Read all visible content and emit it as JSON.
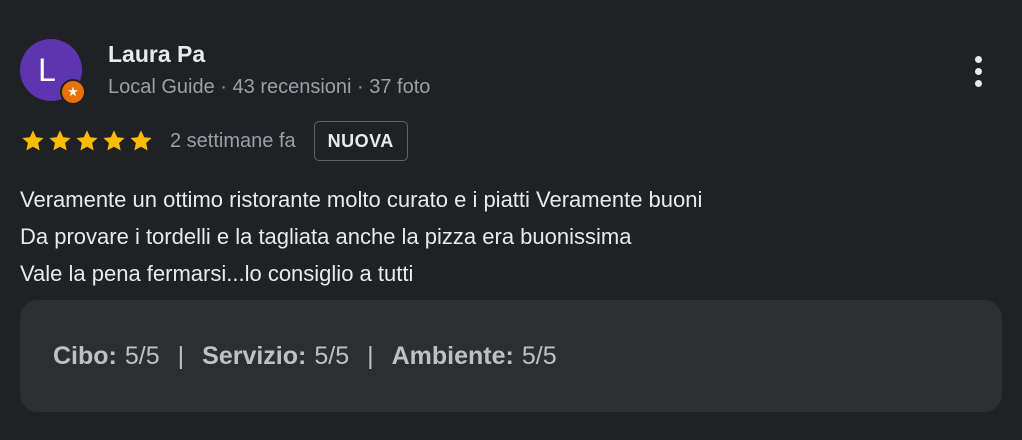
{
  "author": {
    "initial": "L",
    "name": "Laura Pa",
    "meta": "Local Guide · 43 recensioni · 37 foto",
    "badge_icon": "★"
  },
  "review": {
    "stars": 5,
    "date": "2 settimane fa",
    "badge": "NUOVA",
    "text_lines": [
      "Veramente un ottimo ristorante molto curato e i piatti Veramente buoni",
      "Da provare i tordelli e la tagliata anche la pizza era buonissima",
      "Vale la pena fermarsi...lo consiglio a tutti"
    ]
  },
  "ratings": [
    {
      "label": "Cibo:",
      "value": "5/5"
    },
    {
      "label": "Servizio:",
      "value": "5/5"
    },
    {
      "label": "Ambiente:",
      "value": "5/5"
    }
  ],
  "separator": "|",
  "icons": {
    "star": "star-icon",
    "more": "more-vert-icon",
    "guide": "local-guide-badge-icon"
  },
  "colors": {
    "background": "#202124",
    "star": "#fbbc04",
    "avatar": "#5e35b1",
    "guide_badge": "#e8710a",
    "ratings_box": "#2d2e31"
  }
}
